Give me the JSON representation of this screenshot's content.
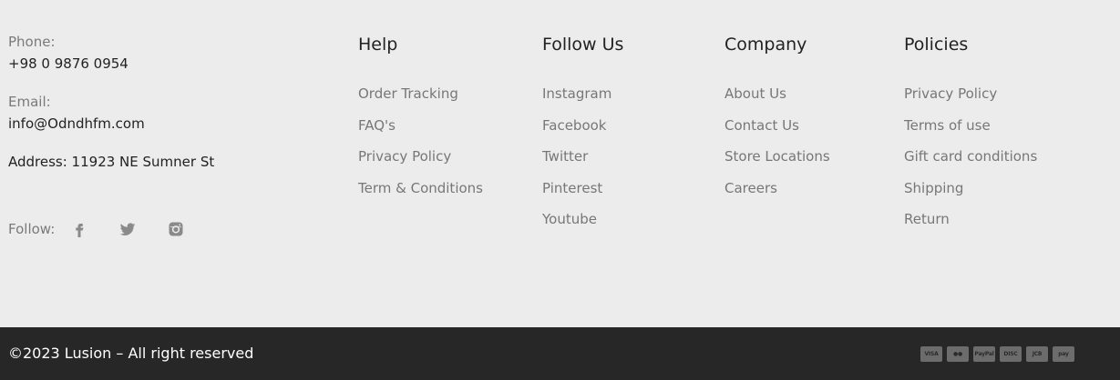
{
  "contact": {
    "phone_label": "Phone:",
    "phone_value": "+98 0 9876 0954",
    "email_label": "Email:",
    "email_value": "info@Odndhfm.com",
    "address": "Address: 11923 NE Sumner St",
    "follow_label": "Follow:",
    "social_icons": [
      "facebook-icon",
      "twitter-icon",
      "instagram-icon"
    ]
  },
  "columns": {
    "help": {
      "title": "Help",
      "items": [
        "Order Tracking",
        "FAQ's",
        "Privacy Policy",
        "Term & Conditions"
      ]
    },
    "follow": {
      "title": "Follow Us",
      "items": [
        "Instagram",
        "Facebook",
        "Twitter",
        "Pinterest",
        "Youtube"
      ]
    },
    "company": {
      "title": "Company",
      "items": [
        "About Us",
        "Contact Us",
        "Store Locations",
        "Careers"
      ]
    },
    "policies": {
      "title": "Policies",
      "items": [
        "Privacy Policy",
        "Terms of use",
        "Gift card conditions",
        "Shipping",
        "Return"
      ]
    }
  },
  "bottom": {
    "copyright": "©2023 Lusion – All right reserved",
    "payment_icons": [
      {
        "name": "visa-icon",
        "label": "VISA"
      },
      {
        "name": "mastercard-icon",
        "label": "●●"
      },
      {
        "name": "paypal-icon",
        "label": "PayPal"
      },
      {
        "name": "discover-icon",
        "label": "DISC"
      },
      {
        "name": "jcb-icon",
        "label": "JCB"
      },
      {
        "name": "pay-icon",
        "label": "pay"
      }
    ]
  },
  "colors": {
    "background": "#ededee",
    "bottom_bar": "#272727",
    "muted_text": "#777777"
  }
}
